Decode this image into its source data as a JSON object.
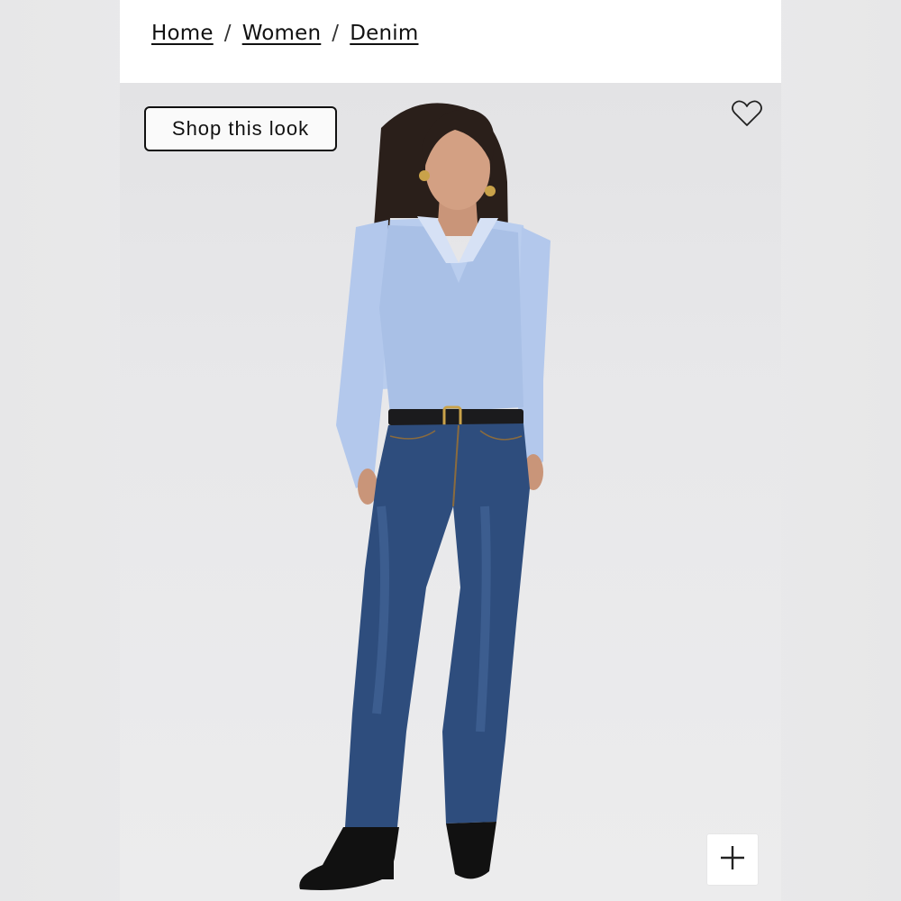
{
  "breadcrumb": {
    "items": [
      {
        "label": "Home"
      },
      {
        "label": "Women"
      },
      {
        "label": "Denim"
      }
    ],
    "separator": "/"
  },
  "hero": {
    "shop_look_label": "Shop this look",
    "wishlist_icon": "heart-outline-icon",
    "zoom_icon": "plus-icon"
  },
  "colors": {
    "text": "#111111",
    "background": "#ffffff",
    "photo_backdrop": "#e6e6e8"
  }
}
